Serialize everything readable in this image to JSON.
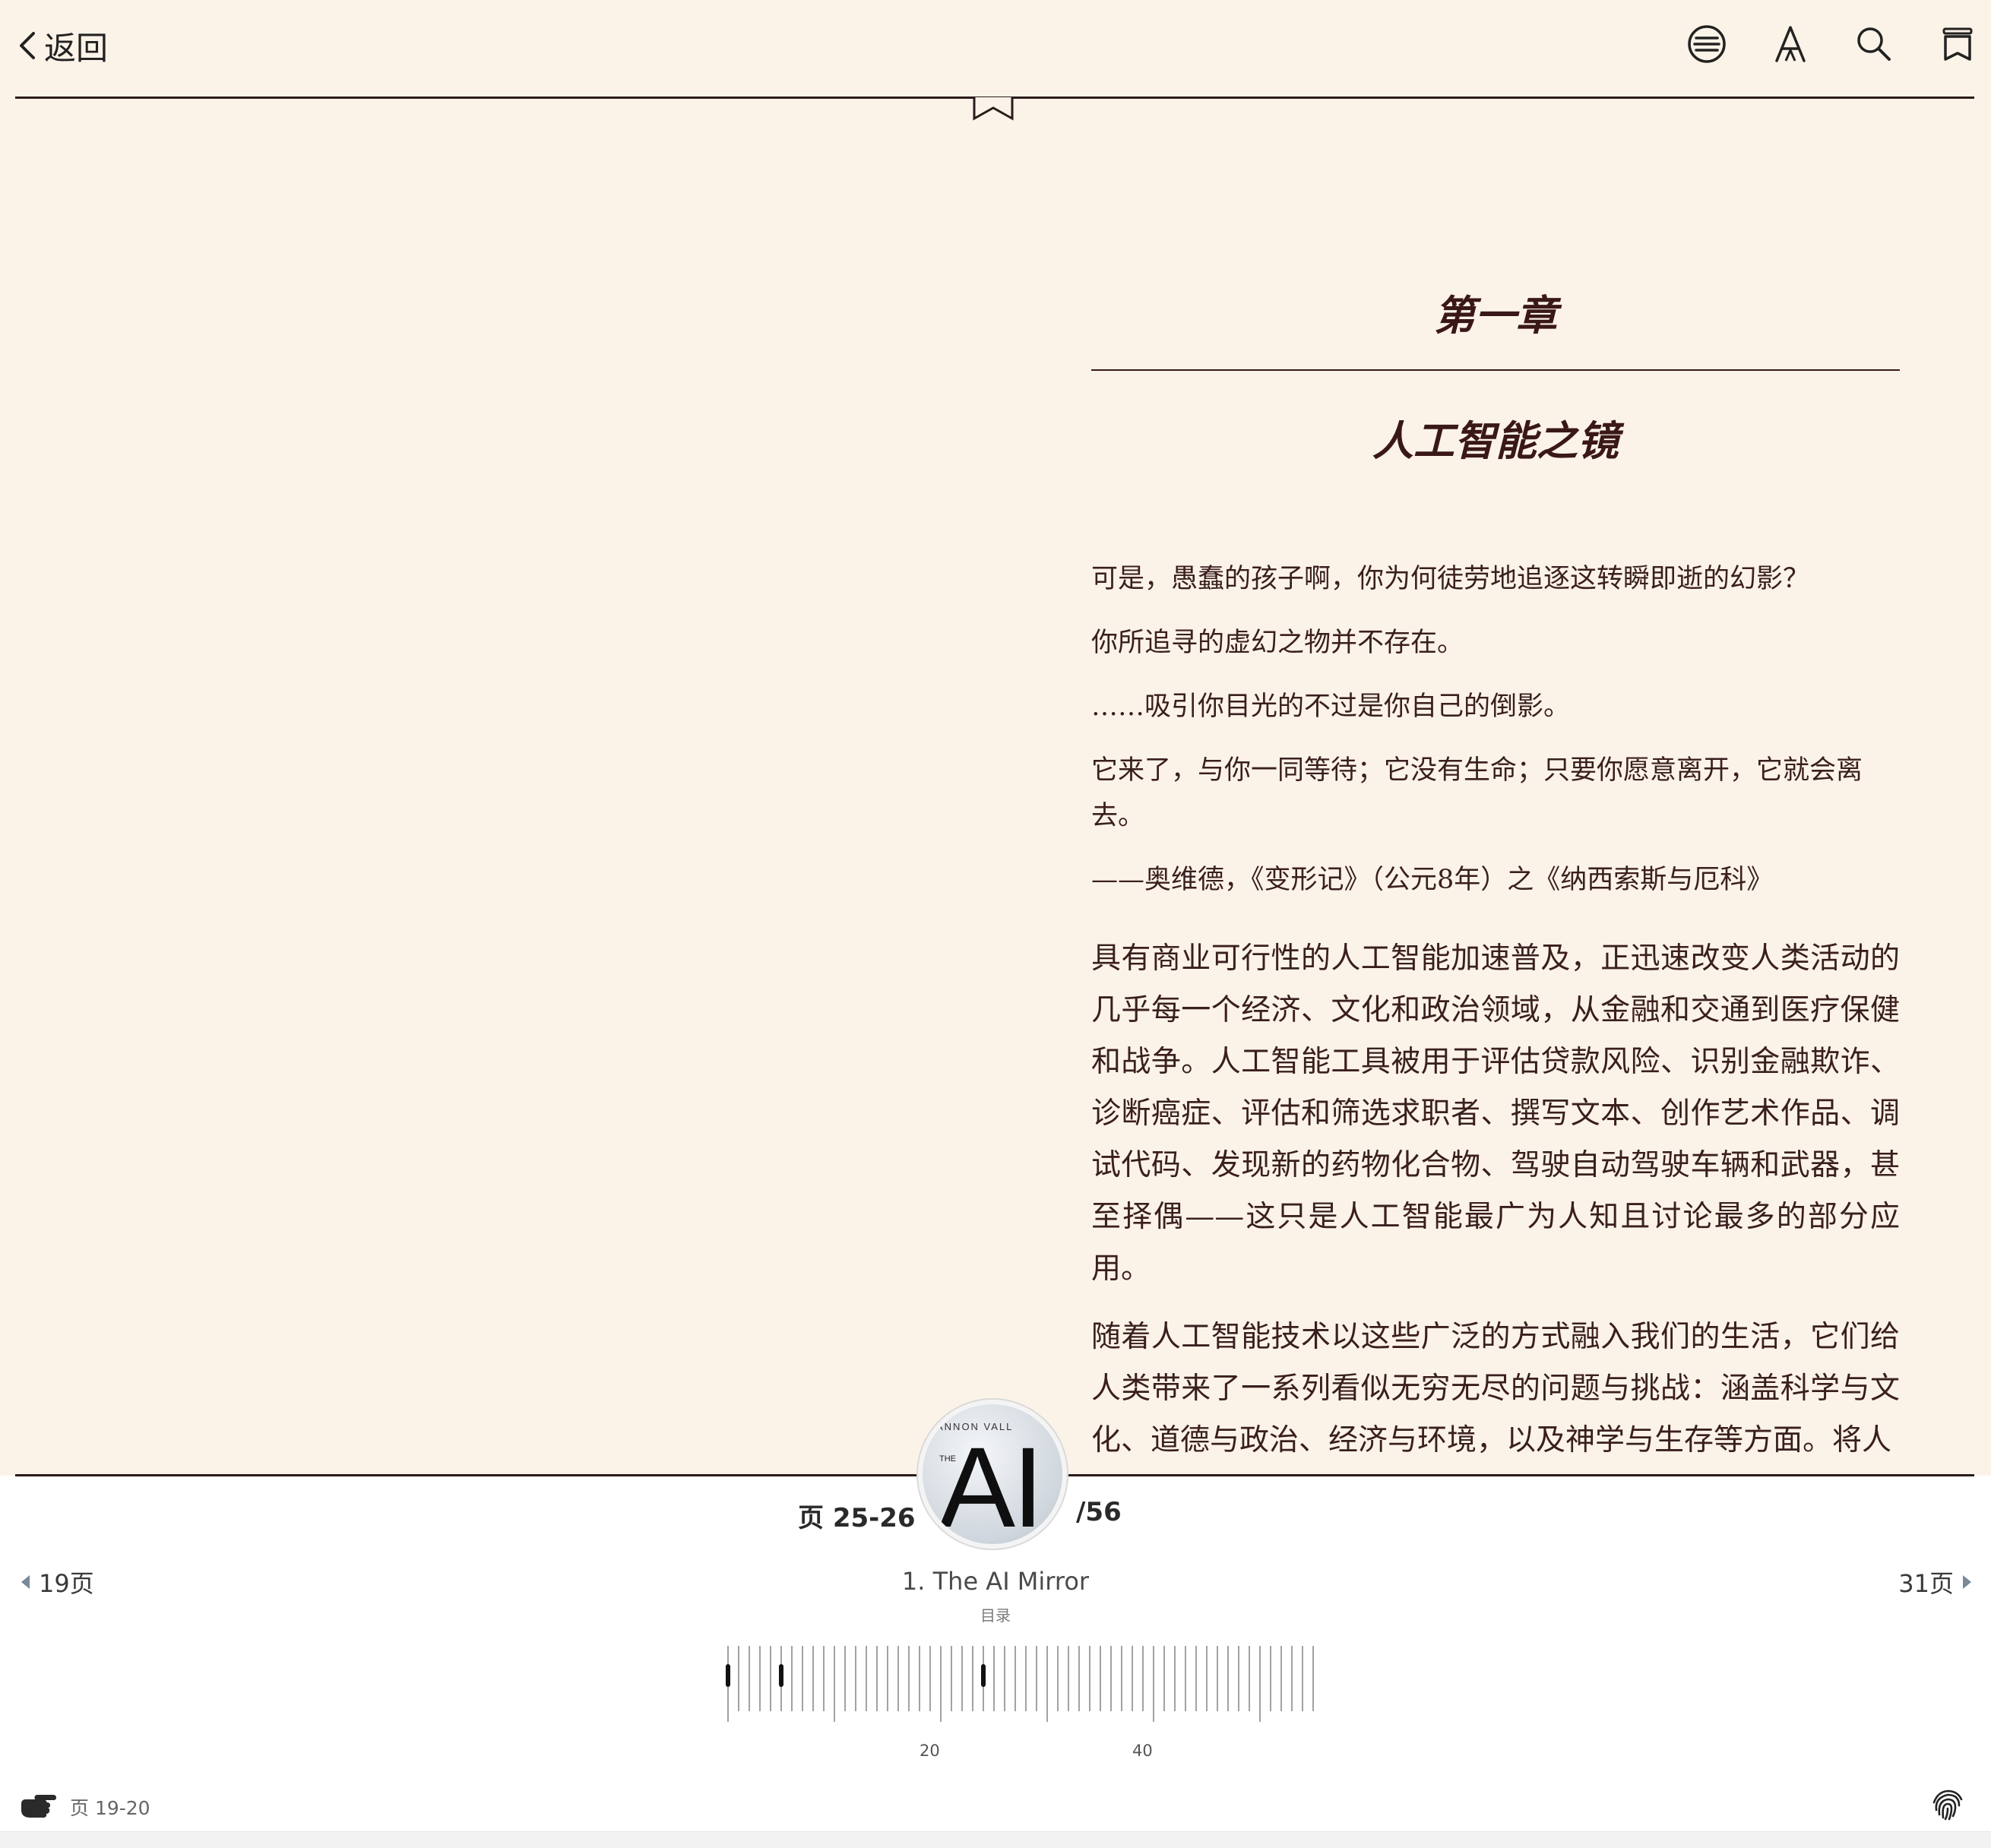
{
  "toolbar": {
    "back_label": "返回"
  },
  "chapter": {
    "number": "第一章",
    "title": "人工智能之镜"
  },
  "epigraph": [
    "可是，愚蠢的孩子啊，你为何徒劳地追逐这转瞬即逝的幻影？",
    "你所追寻的虚幻之物并不存在。",
    "……吸引你目光的不过是你自己的倒影。",
    "它来了，与你一同等待；它没有生命；只要你愿意离开，它就会离去。",
    "——奥维德，《变形记》（公元8年）之《纳西索斯与厄科》"
  ],
  "paragraphs": [
    "具有商业可行性的人工智能加速普及，正迅速改变人类活动的几乎每一个经济、文化和政治领域，从金融和交通到医疗保健和战争。人工智能工具被用于评估贷款风险、识别金融欺诈、诊断癌症、评估和筛选求职者、撰写文本、创作艺术作品、调试代码、发现新的药物化合物、驾驶自动驾驶车辆和武器，甚至择偶——这只是人工智能最广为人知且讨论最多的部分应用。",
    "随着人工智能技术以这些广泛的方式融入我们的生活，它们给人类带来了一系列看似无穷无尽的问题与挑战：涵盖科学与文化、道德与政治、经济与环境，以及神学与生存等方面。将人"
  ],
  "footer": {
    "current_pages": "页 25-26",
    "total_pages": "/56",
    "prev_label": "19页",
    "next_label": "31页",
    "chapter_name": "1. The AI Mirror",
    "toc_label": "目录",
    "tick_labels": [
      "20",
      "40"
    ],
    "history_label": "页 19-20"
  },
  "cover": {
    "author_fragment": "ANNON VALL",
    "the": "THE",
    "ai": "AI"
  },
  "scrubber": {
    "total_pages": 56,
    "current_page": 25,
    "marked_pages": [
      1,
      6
    ]
  },
  "colors": {
    "page_background": "#fcf3e8",
    "text": "#3a1f1f",
    "rule": "#2b1b1b"
  },
  "icons": [
    "chevron-left-icon",
    "contents-icon",
    "font-icon",
    "search-icon",
    "bookmark-icon",
    "hand-pointer-icon",
    "fingerprint-icon"
  ]
}
